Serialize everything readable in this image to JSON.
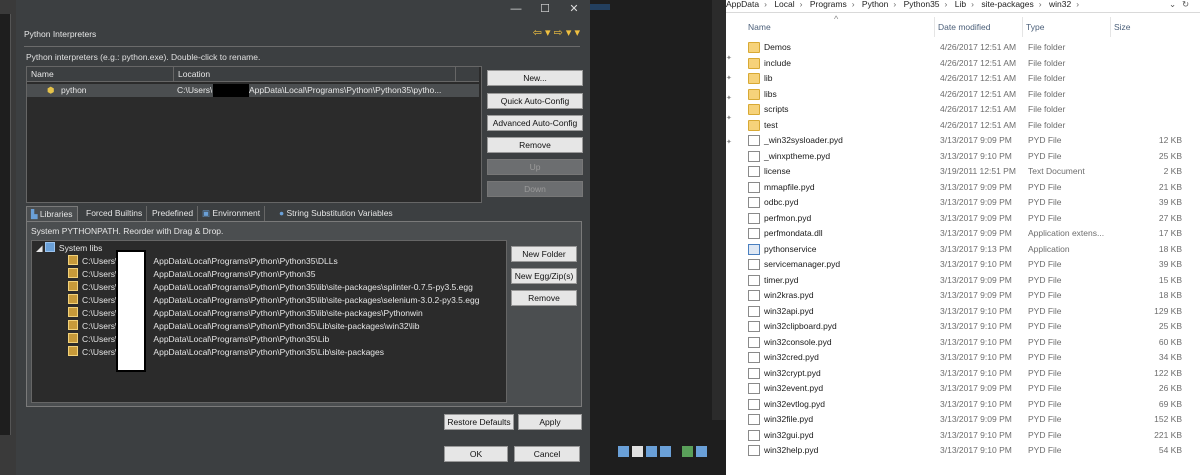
{
  "dialog": {
    "window_controls": {
      "minimize": "—",
      "maximize": "☐",
      "close": "✕"
    },
    "panel_title": "Python Interpreters",
    "nav_icons": "⇦ ▾ ⇨ ▾ ▾",
    "interp_caption": "Python interpreters (e.g.: python.exe).   Double-click to rename.",
    "columns": {
      "name": "Name",
      "location": "Location"
    },
    "interpreter": {
      "name": "python",
      "location_prefix": "C:\\Users\\",
      "location_suffix": "AppData\\Local\\Programs\\Python\\Python35\\pytho..."
    },
    "side_buttons": [
      "New...",
      "Quick Auto-Config",
      "Advanced Auto-Config",
      "Remove",
      "Up",
      "Down"
    ],
    "tabs": [
      "Libraries",
      "Forced Builtins",
      "Predefined",
      "Environment",
      "String Substitution Variables"
    ],
    "pythonpath_caption": "System PYTHONPATH.   Reorder with Drag & Drop.",
    "tree_root": "System libs",
    "lib_prefix": "C:\\Users\\",
    "libs": [
      "AppData\\Local\\Programs\\Python\\Python35\\DLLs",
      "AppData\\Local\\Programs\\Python\\Python35",
      "AppData\\Local\\Programs\\Python\\Python35\\lib\\site-packages\\splinter-0.7.5-py3.5.egg",
      "AppData\\Local\\Programs\\Python\\Python35\\lib\\site-packages\\selenium-3.0.2-py3.5.egg",
      "AppData\\Local\\Programs\\Python\\Python35\\lib\\site-packages\\Pythonwin",
      "AppData\\Local\\Programs\\Python\\Python35\\Lib\\site-packages\\win32\\lib",
      "AppData\\Local\\Programs\\Python\\Python35\\Lib",
      "AppData\\Local\\Programs\\Python\\Python35\\Lib\\site-packages"
    ],
    "lib_buttons": [
      "New Folder",
      "New Egg/Zip(s)",
      "Remove"
    ],
    "restore_defaults": "Restore Defaults",
    "apply": "Apply",
    "ok": "OK",
    "cancel": "Cancel"
  },
  "explorer": {
    "breadcrumbs": [
      "AppData",
      "Local",
      "Programs",
      "Python",
      "Python35",
      "Lib",
      "site-packages",
      "win32"
    ],
    "columns": {
      "name": "Name",
      "date": "Date modified",
      "type": "Type",
      "size": "Size"
    },
    "files": [
      {
        "name": "Demos",
        "date": "4/26/2017 12:51 AM",
        "type": "File folder",
        "size": "",
        "icon": "folder"
      },
      {
        "name": "include",
        "date": "4/26/2017 12:51 AM",
        "type": "File folder",
        "size": "",
        "icon": "folder"
      },
      {
        "name": "lib",
        "date": "4/26/2017 12:51 AM",
        "type": "File folder",
        "size": "",
        "icon": "folder"
      },
      {
        "name": "libs",
        "date": "4/26/2017 12:51 AM",
        "type": "File folder",
        "size": "",
        "icon": "folder"
      },
      {
        "name": "scripts",
        "date": "4/26/2017 12:51 AM",
        "type": "File folder",
        "size": "",
        "icon": "folder"
      },
      {
        "name": "test",
        "date": "4/26/2017 12:51 AM",
        "type": "File folder",
        "size": "",
        "icon": "folder"
      },
      {
        "name": "_win32sysloader.pyd",
        "date": "3/13/2017 9:09 PM",
        "type": "PYD File",
        "size": "12 KB",
        "icon": "doc"
      },
      {
        "name": "_winxptheme.pyd",
        "date": "3/13/2017 9:10 PM",
        "type": "PYD File",
        "size": "25 KB",
        "icon": "doc"
      },
      {
        "name": "license",
        "date": "3/19/2011 12:51 PM",
        "type": "Text Document",
        "size": "2 KB",
        "icon": "doc"
      },
      {
        "name": "mmapfile.pyd",
        "date": "3/13/2017 9:09 PM",
        "type": "PYD File",
        "size": "21 KB",
        "icon": "doc"
      },
      {
        "name": "odbc.pyd",
        "date": "3/13/2017 9:09 PM",
        "type": "PYD File",
        "size": "39 KB",
        "icon": "doc"
      },
      {
        "name": "perfmon.pyd",
        "date": "3/13/2017 9:09 PM",
        "type": "PYD File",
        "size": "27 KB",
        "icon": "doc"
      },
      {
        "name": "perfmondata.dll",
        "date": "3/13/2017 9:09 PM",
        "type": "Application extens...",
        "size": "17 KB",
        "icon": "doc"
      },
      {
        "name": "pythonservice",
        "date": "3/13/2017 9:13 PM",
        "type": "Application",
        "size": "18 KB",
        "icon": "app"
      },
      {
        "name": "servicemanager.pyd",
        "date": "3/13/2017 9:10 PM",
        "type": "PYD File",
        "size": "39 KB",
        "icon": "doc"
      },
      {
        "name": "timer.pyd",
        "date": "3/13/2017 9:09 PM",
        "type": "PYD File",
        "size": "15 KB",
        "icon": "doc"
      },
      {
        "name": "win2kras.pyd",
        "date": "3/13/2017 9:09 PM",
        "type": "PYD File",
        "size": "18 KB",
        "icon": "doc"
      },
      {
        "name": "win32api.pyd",
        "date": "3/13/2017 9:10 PM",
        "type": "PYD File",
        "size": "129 KB",
        "icon": "doc"
      },
      {
        "name": "win32clipboard.pyd",
        "date": "3/13/2017 9:10 PM",
        "type": "PYD File",
        "size": "25 KB",
        "icon": "doc"
      },
      {
        "name": "win32console.pyd",
        "date": "3/13/2017 9:10 PM",
        "type": "PYD File",
        "size": "60 KB",
        "icon": "doc"
      },
      {
        "name": "win32cred.pyd",
        "date": "3/13/2017 9:10 PM",
        "type": "PYD File",
        "size": "34 KB",
        "icon": "doc"
      },
      {
        "name": "win32crypt.pyd",
        "date": "3/13/2017 9:10 PM",
        "type": "PYD File",
        "size": "122 KB",
        "icon": "doc"
      },
      {
        "name": "win32event.pyd",
        "date": "3/13/2017 9:09 PM",
        "type": "PYD File",
        "size": "26 KB",
        "icon": "doc"
      },
      {
        "name": "win32evtlog.pyd",
        "date": "3/13/2017 9:10 PM",
        "type": "PYD File",
        "size": "69 KB",
        "icon": "doc"
      },
      {
        "name": "win32file.pyd",
        "date": "3/13/2017 9:09 PM",
        "type": "PYD File",
        "size": "152 KB",
        "icon": "doc"
      },
      {
        "name": "win32gui.pyd",
        "date": "3/13/2017 9:10 PM",
        "type": "PYD File",
        "size": "221 KB",
        "icon": "doc"
      },
      {
        "name": "win32help.pyd",
        "date": "3/13/2017 9:10 PM",
        "type": "PYD File",
        "size": "54 KB",
        "icon": "doc"
      }
    ]
  }
}
